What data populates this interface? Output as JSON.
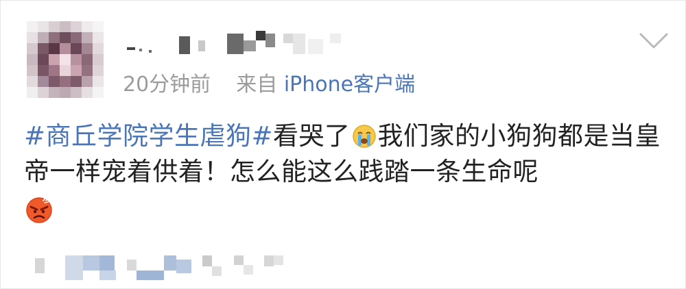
{
  "post": {
    "timestamp": "20分钟前",
    "source_prefix": "来自",
    "source_client": "iPhone客户端",
    "hashtag": "#商丘学院学生虐狗#",
    "text_part1": "看哭了",
    "text_part2": "我们家的小狗狗都是当皇帝一样宠着供着！怎么能这么践踏一条生命呢"
  },
  "icons": {
    "menu": "chevron-down-icon",
    "emoji_cry": "crying-face-emoji-icon",
    "emoji_angry": "angry-face-emoji-icon"
  },
  "colors": {
    "link": "#4a76b7",
    "meta": "#9b9b9b",
    "text": "#222222"
  }
}
